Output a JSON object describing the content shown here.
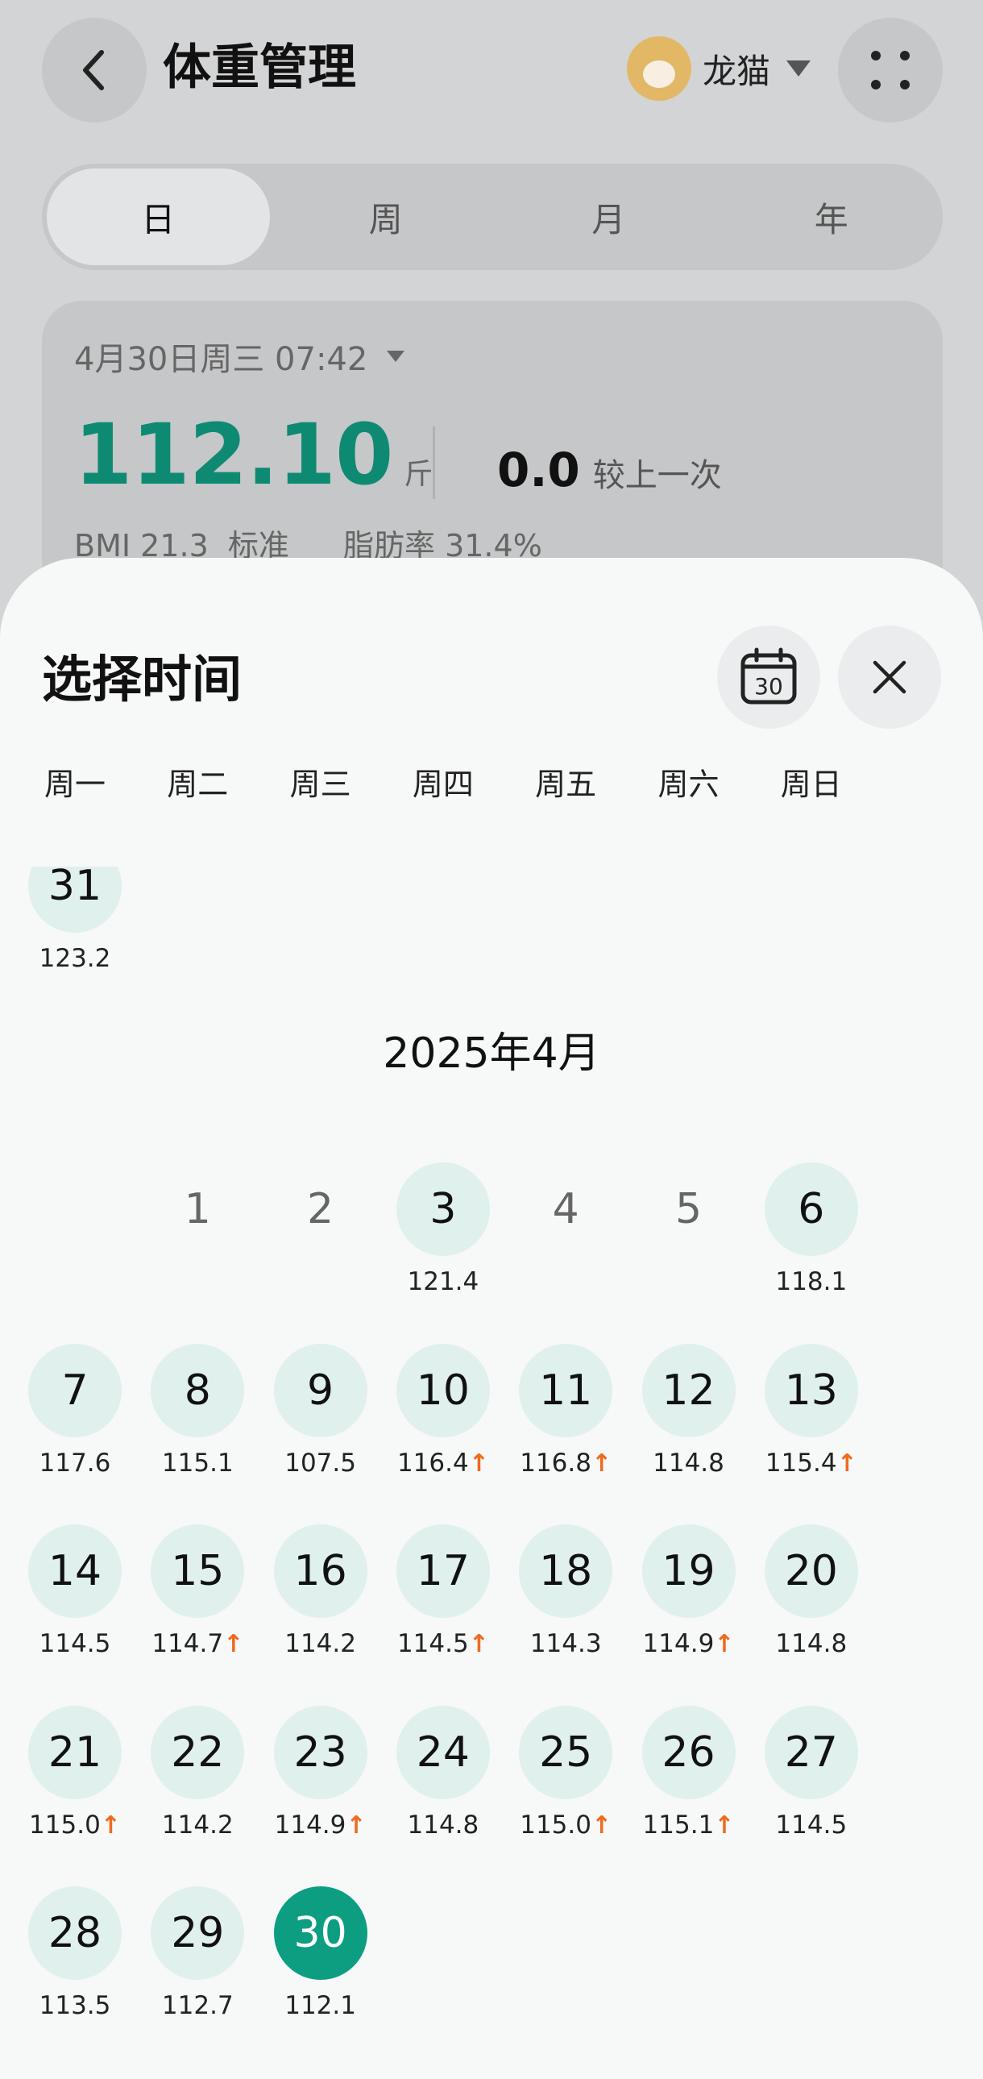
{
  "header": {
    "title": "体重管理",
    "user_name": "龙猫"
  },
  "tabs": [
    "日",
    "周",
    "月",
    "年"
  ],
  "active_tab": 0,
  "summary": {
    "date_time": "4月30日周三 07:42",
    "weight": "112.10",
    "unit": "斤",
    "change_value": "0.0",
    "change_label": "较上一次",
    "bmi": "BMI 21.3  标准",
    "fat": "脂肪率 31.4%"
  },
  "sheet": {
    "title": "选择时间",
    "calendar_icon_day": "30",
    "weekdays": [
      "周一",
      "周二",
      "周三",
      "周四",
      "周五",
      "周六",
      "周日"
    ],
    "prev_month_tail": {
      "day": "31",
      "value": "123.2"
    },
    "month_label": "2025年4月",
    "first_weekday_col": 1,
    "days": [
      {
        "day": "1",
        "value": "",
        "up": false,
        "recorded": false
      },
      {
        "day": "2",
        "value": "",
        "up": false,
        "recorded": false
      },
      {
        "day": "3",
        "value": "121.4",
        "up": false,
        "recorded": true
      },
      {
        "day": "4",
        "value": "",
        "up": false,
        "recorded": false
      },
      {
        "day": "5",
        "value": "",
        "up": false,
        "recorded": false
      },
      {
        "day": "6",
        "value": "118.1",
        "up": false,
        "recorded": true
      },
      {
        "day": "7",
        "value": "117.6",
        "up": false,
        "recorded": true
      },
      {
        "day": "8",
        "value": "115.1",
        "up": false,
        "recorded": true
      },
      {
        "day": "9",
        "value": "107.5",
        "up": false,
        "recorded": true
      },
      {
        "day": "10",
        "value": "116.4",
        "up": true,
        "recorded": true
      },
      {
        "day": "11",
        "value": "116.8",
        "up": true,
        "recorded": true
      },
      {
        "day": "12",
        "value": "114.8",
        "up": false,
        "recorded": true
      },
      {
        "day": "13",
        "value": "115.4",
        "up": true,
        "recorded": true
      },
      {
        "day": "14",
        "value": "114.5",
        "up": false,
        "recorded": true
      },
      {
        "day": "15",
        "value": "114.7",
        "up": true,
        "recorded": true
      },
      {
        "day": "16",
        "value": "114.2",
        "up": false,
        "recorded": true
      },
      {
        "day": "17",
        "value": "114.5",
        "up": true,
        "recorded": true
      },
      {
        "day": "18",
        "value": "114.3",
        "up": false,
        "recorded": true
      },
      {
        "day": "19",
        "value": "114.9",
        "up": true,
        "recorded": true
      },
      {
        "day": "20",
        "value": "114.8",
        "up": false,
        "recorded": true
      },
      {
        "day": "21",
        "value": "115.0",
        "up": true,
        "recorded": true
      },
      {
        "day": "22",
        "value": "114.2",
        "up": false,
        "recorded": true
      },
      {
        "day": "23",
        "value": "114.9",
        "up": true,
        "recorded": true
      },
      {
        "day": "24",
        "value": "114.8",
        "up": false,
        "recorded": true
      },
      {
        "day": "25",
        "value": "115.0",
        "up": true,
        "recorded": true
      },
      {
        "day": "26",
        "value": "115.1",
        "up": true,
        "recorded": true
      },
      {
        "day": "27",
        "value": "114.5",
        "up": false,
        "recorded": true
      },
      {
        "day": "28",
        "value": "113.5",
        "up": false,
        "recorded": true
      },
      {
        "day": "29",
        "value": "112.7",
        "up": false,
        "recorded": true
      },
      {
        "day": "30",
        "value": "112.1",
        "up": false,
        "recorded": true,
        "selected": true
      }
    ],
    "up_arrow": "↑"
  },
  "colors": {
    "accent": "#0d9e82",
    "weight_text": "#0e8a73",
    "up_arrow": "#f06a1e",
    "recorded_bg": "#e0f0ed"
  }
}
